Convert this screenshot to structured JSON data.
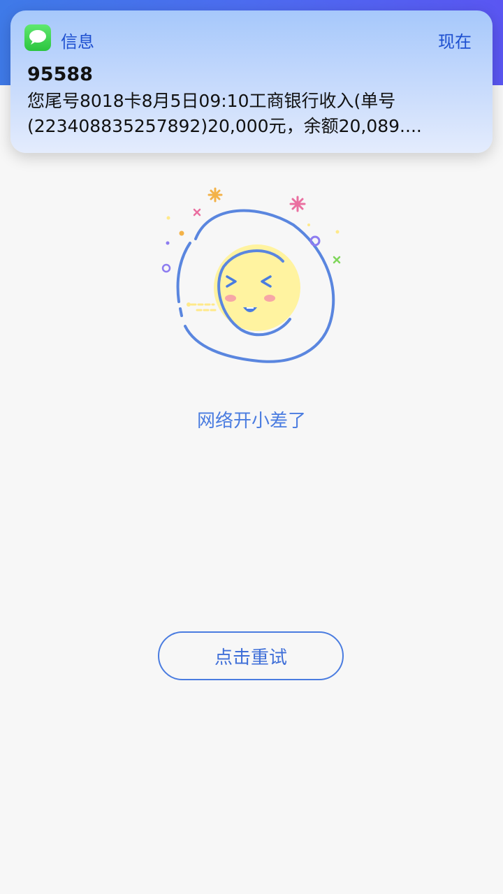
{
  "notification": {
    "app_name": "信息",
    "time": "现在",
    "sender": "95588",
    "body": "您尾号8018卡8月5日09:10工商银行收入(单号\n(223408835257892)20,000元，余额20,089...."
  },
  "icons": {
    "app": "message-bubble-icon",
    "illustration": "smiling-face-illustration"
  },
  "page": {
    "error_message": "网络开小差了",
    "retry_label": "点击重试"
  },
  "colors": {
    "accent": "#4a7ce0",
    "face": "#fff3a0",
    "blush": "#f7a6a6"
  }
}
